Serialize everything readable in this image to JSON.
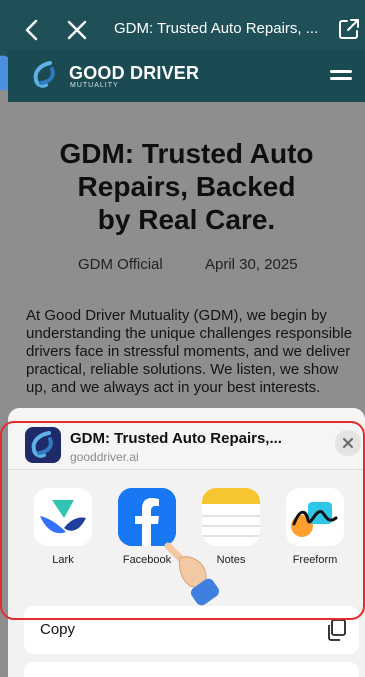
{
  "browser": {
    "title": "GDM: Trusted Auto Repairs, ..."
  },
  "site": {
    "logo_text": "GOOD DRIVER",
    "logo_sub": "MUTUALITY"
  },
  "article": {
    "headline_lines": [
      "GDM: Trusted Auto",
      "Repairs, Backed",
      "by Real Care."
    ],
    "author": "GDM Official",
    "date": "April 30, 2025",
    "body": "At Good Driver Mutuality (GDM), we begin by understanding the unique challenges responsible drivers face in stressful moments, and we deliver practical, reliable solutions. We listen, we show up, and we always act in your best interests."
  },
  "share_sheet": {
    "title": "GDM: Trusted Auto Repairs,...",
    "url": "gooddriver.ai",
    "apps": [
      {
        "label": "Lark",
        "icon": "lark-icon"
      },
      {
        "label": "Facebook",
        "icon": "facebook-icon"
      },
      {
        "label": "Notes",
        "icon": "notes-icon"
      },
      {
        "label": "Freeform",
        "icon": "freeform-icon"
      }
    ],
    "copy_label": "Copy"
  },
  "colors": {
    "topbar": "#1f5058",
    "highlight": "#e52b2b",
    "facebook": "#1877f2"
  }
}
